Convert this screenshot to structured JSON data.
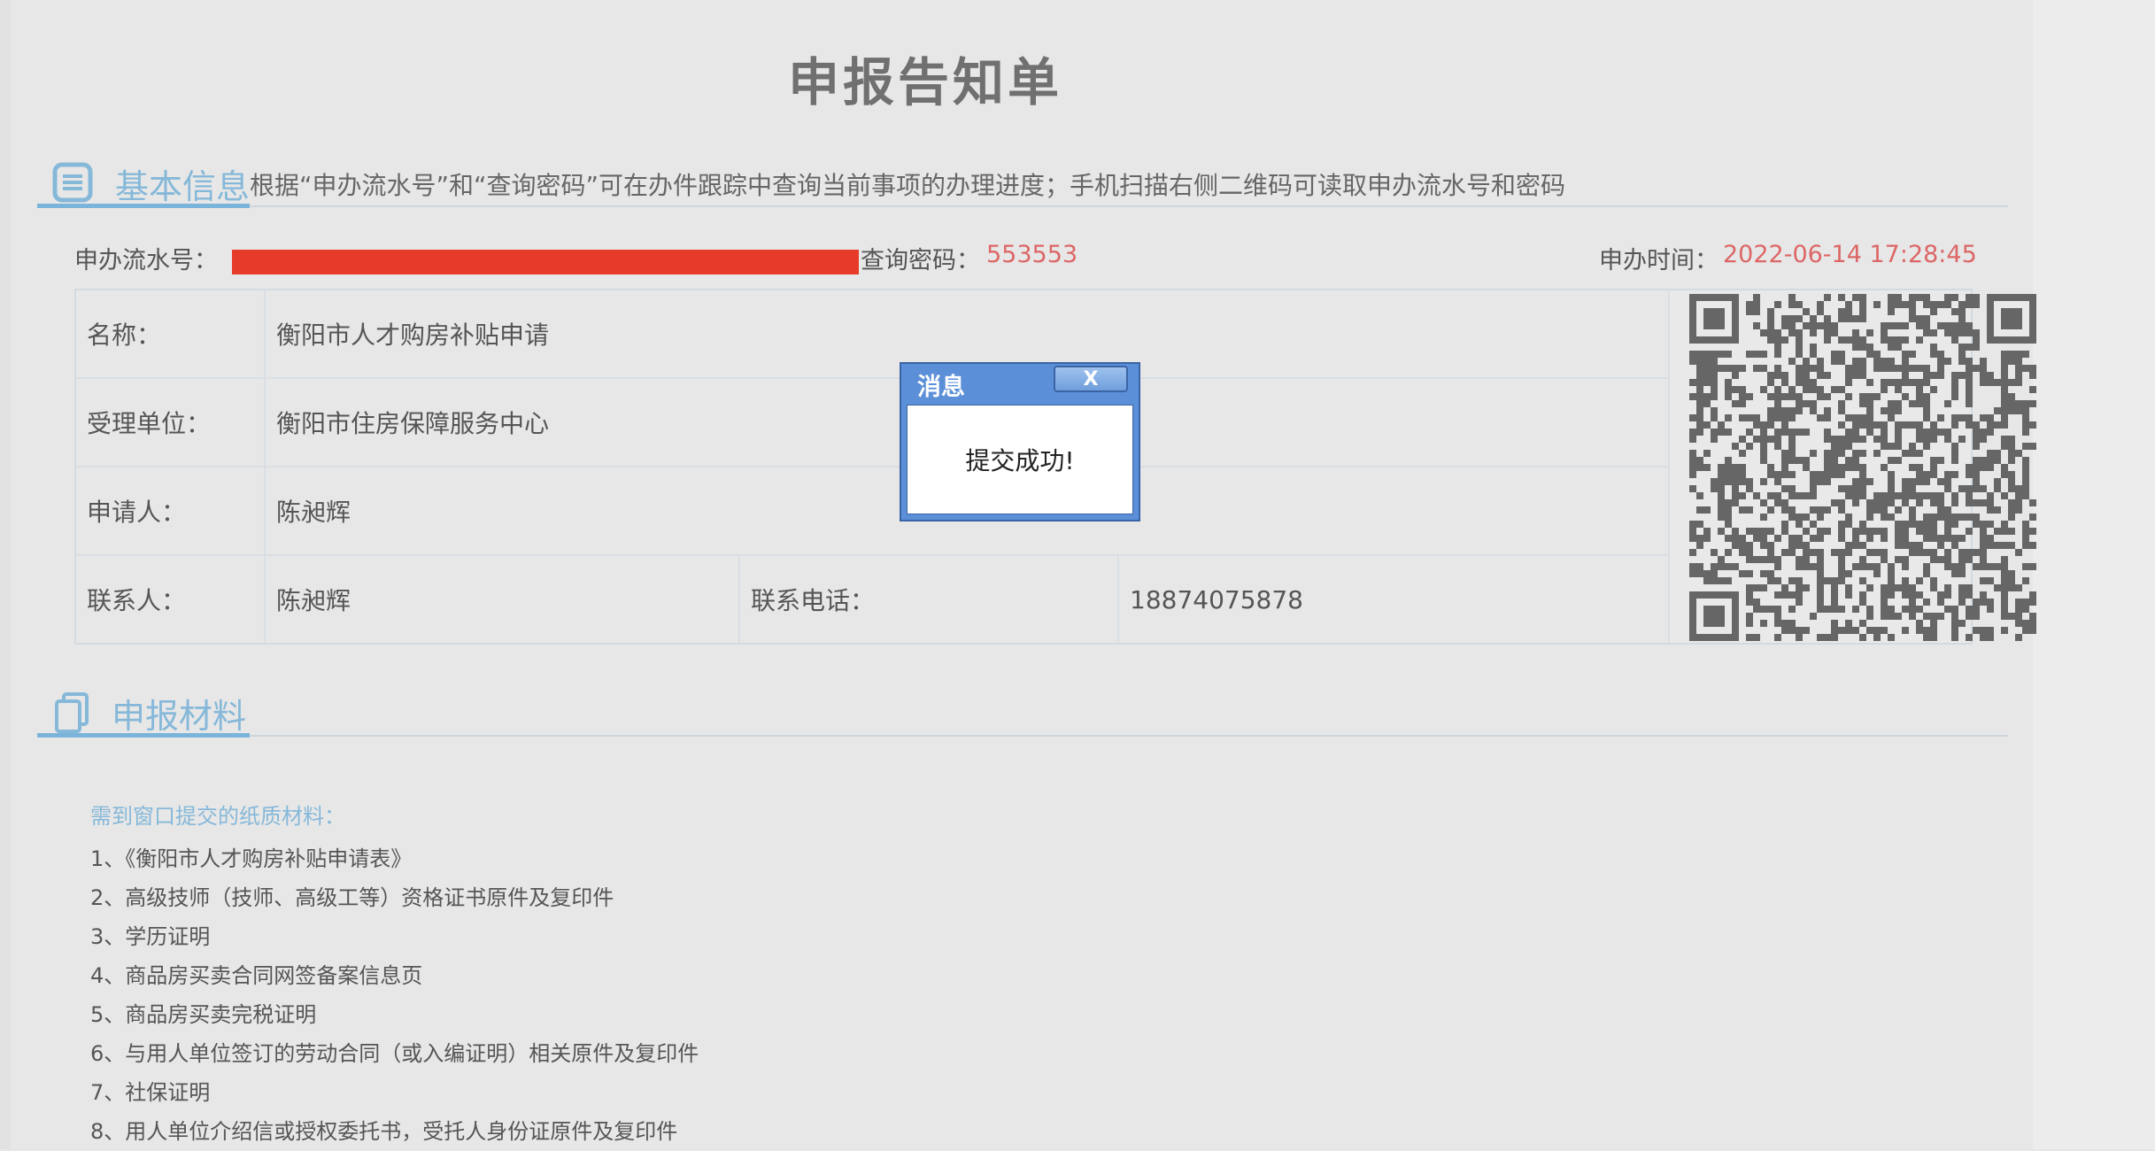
{
  "page_title": "申报告知单",
  "basic_info": {
    "title": "基本信息",
    "icon": "list-doc-icon",
    "hint": "根据“申办流水号”和“查询密码”可在办件跟踪中查询当前事项的办理进度；手机扫描右侧二维码可读取申办流水号和密码"
  },
  "meta": {
    "serial_label": "申办流水号：",
    "query_label": "查询密码：",
    "query_value": "553553",
    "time_label": "申办时间：",
    "time_value": "2022-06-14 17:28:45"
  },
  "table": {
    "name_label": "名称：",
    "name_value": "衡阳市人才购房补贴申请",
    "unit_label": "受理单位：",
    "unit_value": "衡阳市住房保障服务中心",
    "applicant_label": "申请人：",
    "applicant_value": "陈昶辉",
    "contact_label": "联系人：",
    "contact_value": "陈昶辉",
    "phone_label": "联系电话：",
    "phone_value": "18874075878"
  },
  "materials": {
    "title": "申报材料",
    "icon": "copy-doc-icon",
    "paper_heading": "需到窗口提交的纸质材料：",
    "items": [
      "1、《衡阳市人才购房补贴申请表》",
      "2、高级技师（技师、高级工等）资格证书原件及复印件",
      "3、学历证明",
      "4、商品房买卖合同网签备案信息页",
      "5、商品房买卖完税证明",
      "6、与用人单位签订的劳动合同（或入编证明）相关原件及复印件",
      "7、社保证明",
      "8、用人单位介绍信或授权委托书，受托人身份证原件及复印件"
    ]
  },
  "dialog": {
    "title": "消息",
    "close_label": "X",
    "message": "提交成功!"
  },
  "colors": {
    "accent_blue": "#86b8d9",
    "value_red": "#dd6666",
    "dialog_blue": "#5b8fd8",
    "redaction": "#e63b28"
  }
}
